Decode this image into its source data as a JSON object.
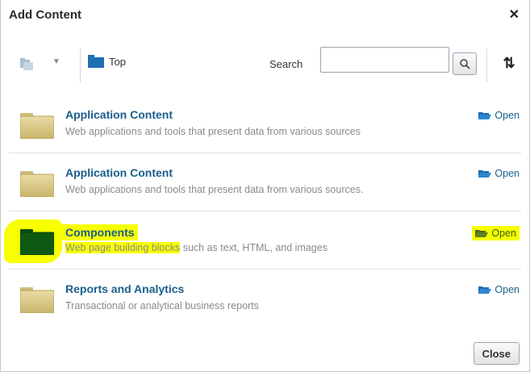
{
  "dialog": {
    "title": "Add Content",
    "close_glyph": "✕"
  },
  "toolbar": {
    "top_label": "Top",
    "search_label": "Search",
    "search_value": "",
    "search_placeholder": ""
  },
  "items": [
    {
      "title": "Application Content",
      "description": "Web applications and tools that present data from various sources",
      "open_label": "Open"
    },
    {
      "title": "Application Content",
      "description": "Web applications and tools that present data from various sources.",
      "open_label": "Open"
    },
    {
      "title": "Components",
      "description_highlighted": "Web page building blocks",
      "description_rest": " such as text, HTML, and images",
      "open_label": "Open"
    },
    {
      "title": "Reports and Analytics",
      "description": "Transactional or analytical business reports",
      "open_label": "Open"
    }
  ],
  "footer": {
    "close_label": "Close"
  },
  "colors": {
    "link": "#1a5e8c",
    "highlight": "#f7ff00",
    "folder_tan": "#d9c98a",
    "folder_green": "#0f5a12"
  }
}
